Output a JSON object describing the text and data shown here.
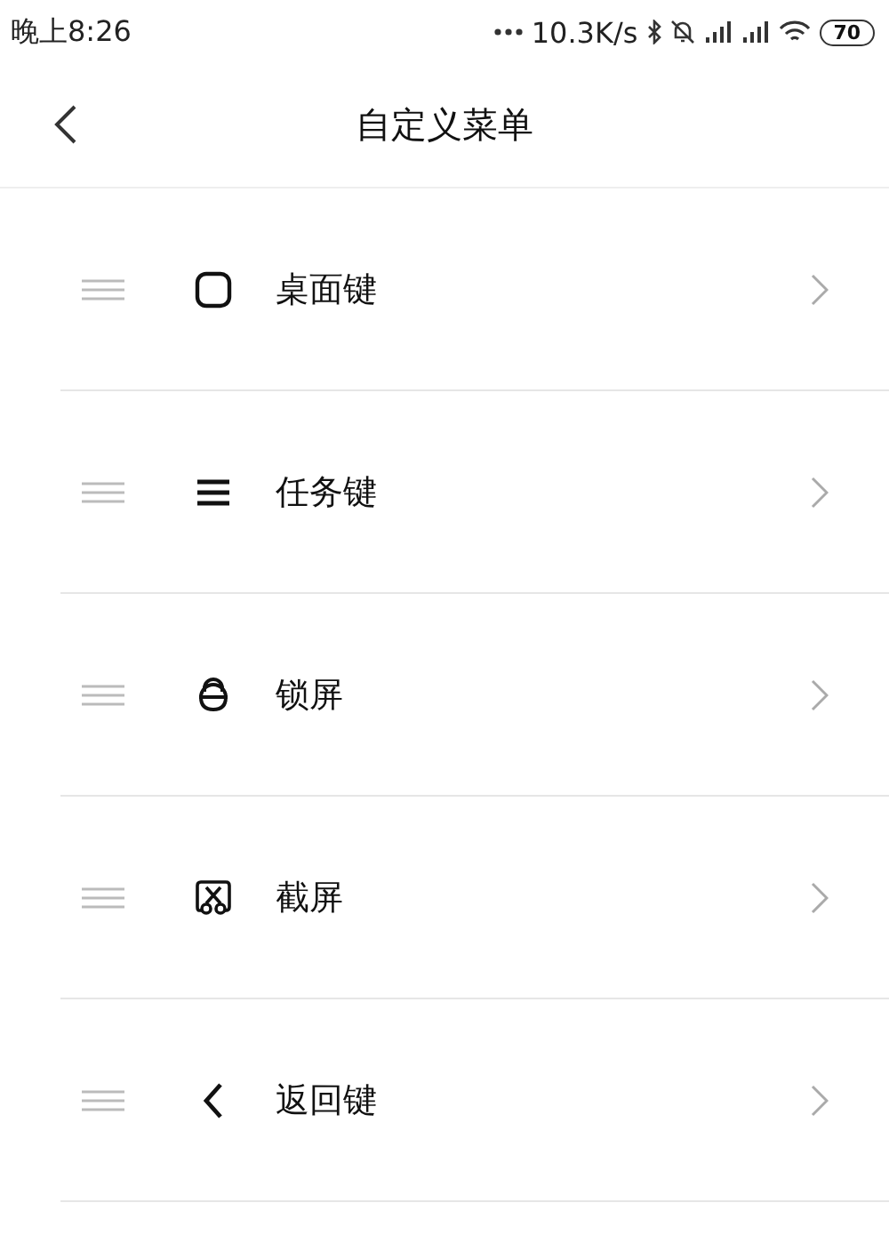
{
  "status_bar": {
    "time": "晚上8:26",
    "speed": "10.3K/s",
    "battery": "70"
  },
  "header": {
    "title": "自定义菜单"
  },
  "items": [
    {
      "kind": "home",
      "label": "桌面键"
    },
    {
      "kind": "tasks",
      "label": "任务键"
    },
    {
      "kind": "lock",
      "label": "锁屏"
    },
    {
      "kind": "screenshot",
      "label": "截屏"
    },
    {
      "kind": "back",
      "label": "返回键"
    }
  ]
}
